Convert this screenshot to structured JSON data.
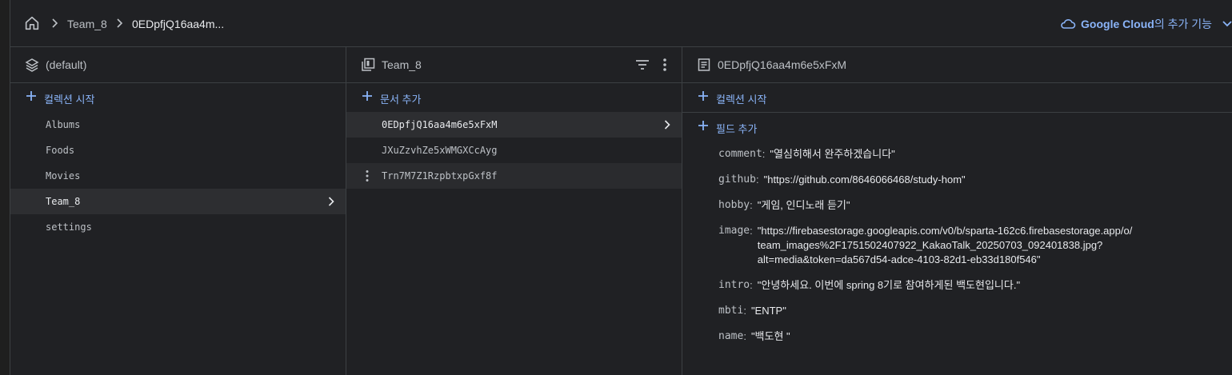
{
  "breadcrumb": {
    "items": [
      "Team_8",
      "0EDpfjQ16aa4m..."
    ]
  },
  "header_right": {
    "brand": "Google Cloud",
    "suffix": "의 추가 기능"
  },
  "columns": {
    "database": {
      "title": "(default)",
      "add_label": "컬렉션 시작",
      "items": [
        "Albums",
        "Foods",
        "Movies",
        "Team_8",
        "settings"
      ],
      "selected": "Team_8"
    },
    "collection": {
      "title": "Team_8",
      "add_label": "문서 추가",
      "items": [
        "0EDpfjQ16aa4m6e5xFxM",
        "JXuZzvhZe5xWMGXCcAyg",
        "Trn7M7Z1RzpbtxpGxf8f"
      ],
      "selected": "0EDpfjQ16aa4m6e5xFxM"
    },
    "document": {
      "title": "0EDpfjQ16aa4m6e5xFxM",
      "add_collection_label": "컬렉션 시작",
      "add_field_label": "필드 추가",
      "fields": [
        {
          "key": "comment",
          "value": "\"열심히해서 완주하겠습니다\""
        },
        {
          "key": "github",
          "value": "\"https://github.com/8646066468/study-hom\""
        },
        {
          "key": "hobby",
          "value": "\"게임, 인디노래 듣기\""
        },
        {
          "key": "image",
          "value_lines": [
            "\"https://firebasestorage.googleapis.com/v0/b/sparta-162c6.firebasestorage.app/o/",
            "team_images%2F1751502407922_KakaoTalk_20250703_092401838.jpg?",
            "alt=media&token=da567d54-adce-4103-82d1-eb33d180f546\""
          ]
        },
        {
          "key": "intro",
          "value": "\"안녕하세요. 이번에 spring 8기로 참여하게된 백도현입니다.\""
        },
        {
          "key": "mbti",
          "value": "\"ENTP\""
        },
        {
          "key": "name",
          "value": "\"백도현 \""
        }
      ]
    }
  },
  "colors": {
    "accent": "#8ab4f8",
    "background": "#202124",
    "border": "#3c4043",
    "selected_row": "#2d2e31"
  }
}
